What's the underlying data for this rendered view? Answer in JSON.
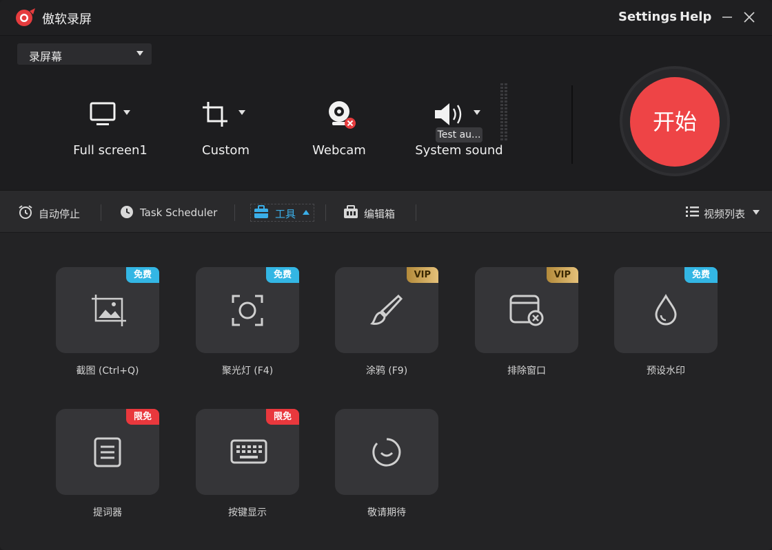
{
  "app": {
    "title": "傲软录屏",
    "menu": {
      "settings": "Settings",
      "help": "Help"
    },
    "colors": {
      "accent": "#ee4446",
      "free": "#33b6e4",
      "vip": "#e5c17a",
      "limited": "#e9383d",
      "tools_active": "#3aaee8"
    }
  },
  "record": {
    "mode": "录屏幕",
    "sources": {
      "fullscreen": "Full screen1",
      "custom": "Custom",
      "webcam": "Webcam",
      "sound": "System sound"
    },
    "sound_tooltip": "Test au...",
    "start_label": "开始"
  },
  "toolbar": {
    "auto_stop": "自动停止",
    "task_scheduler": "Task Scheduler",
    "tools": "工具",
    "editor": "编辑箱",
    "video_list": "视频列表"
  },
  "tools": [
    {
      "label": "截图 (Ctrl+Q)",
      "badge": "免费",
      "icon": "screenshot-icon"
    },
    {
      "label": "聚光灯 (F4)",
      "badge": "免费",
      "icon": "spotlight-icon"
    },
    {
      "label": "涂鸦 (F9)",
      "badge": "VIP",
      "icon": "brush-icon"
    },
    {
      "label": "排除窗口",
      "badge": "VIP",
      "icon": "exclude-window-icon"
    },
    {
      "label": "预设水印",
      "badge": "免费",
      "icon": "watermark-drop-icon"
    },
    {
      "label": "提词器",
      "badge": "限免",
      "icon": "teleprompter-icon"
    },
    {
      "label": "按键显示",
      "badge": "限免",
      "icon": "keyboard-icon"
    },
    {
      "label": "敬请期待",
      "badge": "",
      "icon": "coming-soon-icon"
    }
  ]
}
